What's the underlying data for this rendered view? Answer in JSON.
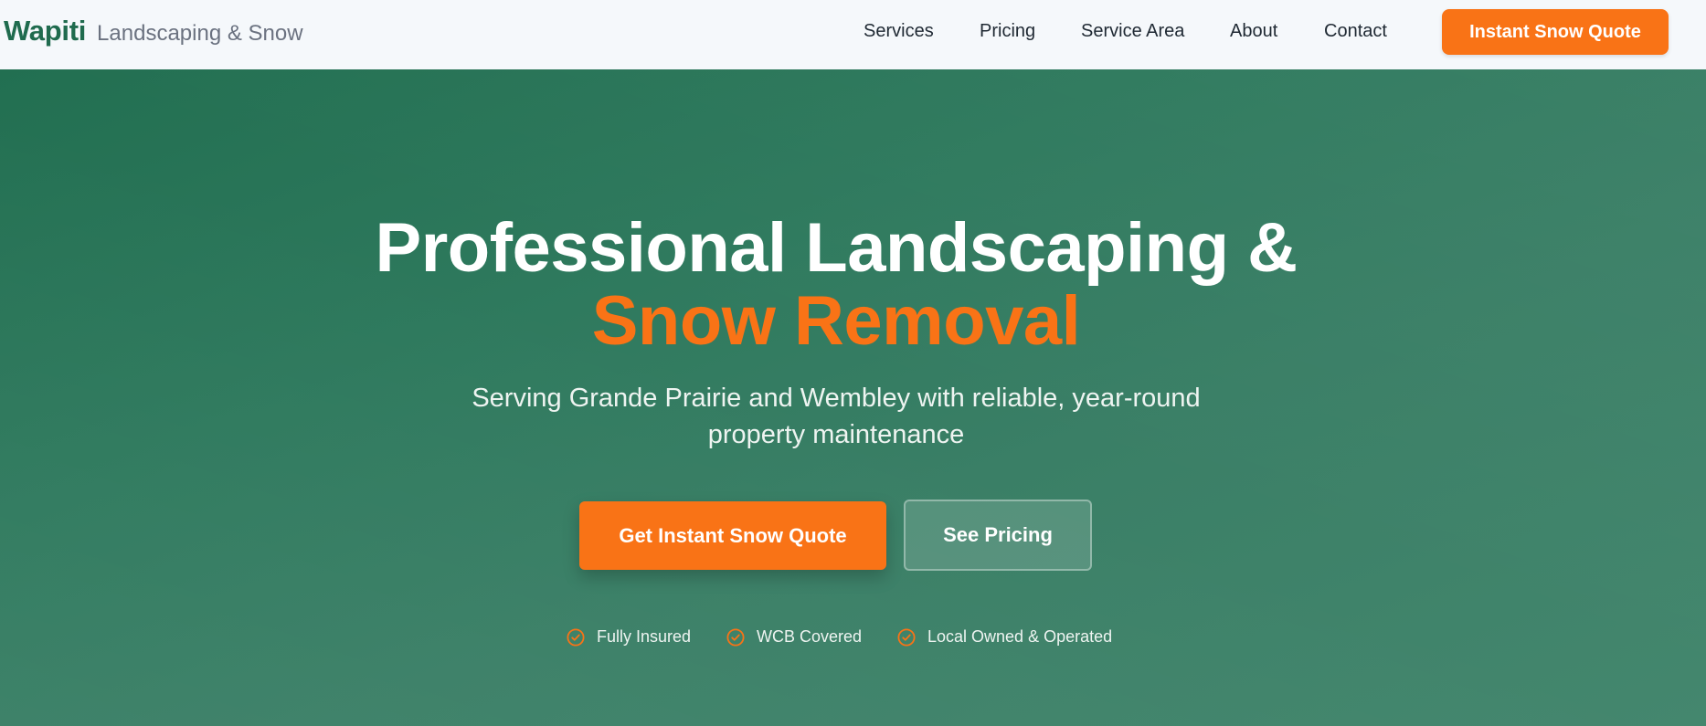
{
  "header": {
    "brand_name": "Wapiti",
    "brand_tagline": "Landscaping & Snow",
    "nav": [
      {
        "label": "Services"
      },
      {
        "label": "Pricing"
      },
      {
        "label": "Service Area"
      },
      {
        "label": "About"
      },
      {
        "label": "Contact"
      }
    ],
    "cta_label": "Instant Snow Quote"
  },
  "hero": {
    "title_line1": "Professional Landscaping &",
    "title_line2": "Snow Removal",
    "subtitle": "Serving Grande Prairie and Wembley with reliable, year-round property maintenance",
    "primary_button": "Get Instant Snow Quote",
    "secondary_button": "See Pricing",
    "badges": [
      {
        "icon": "check-circle-icon",
        "label": "Fully Insured"
      },
      {
        "icon": "check-circle-icon",
        "label": "WCB Covered"
      },
      {
        "icon": "check-circle-icon",
        "label": "Local Owned & Operated"
      }
    ]
  },
  "colors": {
    "brand_green": "#1f6b4e",
    "accent_orange": "#f97316",
    "hero_green": "#2f7a5e"
  }
}
